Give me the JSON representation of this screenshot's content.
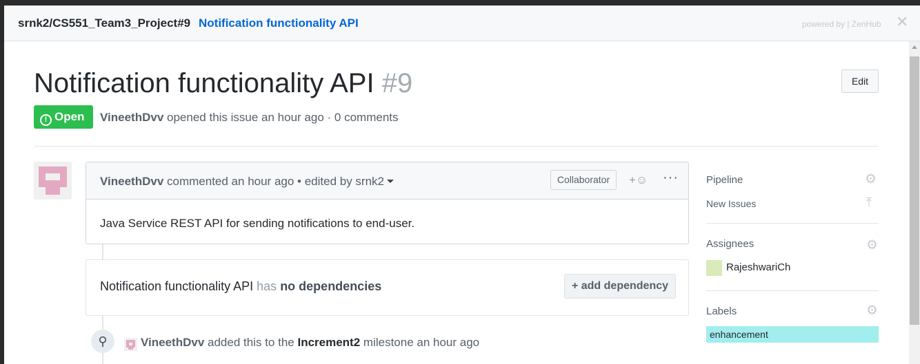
{
  "topbar": {
    "repo": "srnk2/CS551_Team3_Project#9",
    "issue_title": "Notification functionality API",
    "powered_by": "powered by | ZenHub",
    "close_icon": "close-icon"
  },
  "issue": {
    "title": "Notification functionality API",
    "number": "#9",
    "edit_label": "Edit",
    "state": "Open",
    "author": "VineethDvv",
    "meta_text": "opened this issue an hour ago · 0 comments"
  },
  "comment": {
    "author": "VineethDvv",
    "action": "commented an hour ago • edited by srnk2",
    "badge": "Collaborator",
    "reaction": "+☺",
    "more": "···",
    "body": "Java Service REST API for sending notifications to end-user."
  },
  "dependencies": {
    "title": "Notification functionality API",
    "has": "has",
    "status": "no dependencies",
    "button": "+ add dependency"
  },
  "event": {
    "actor": "VineethDvv",
    "prefix": "added this to the",
    "milestone": "Increment2",
    "suffix": "milestone an hour ago"
  },
  "sidebar": {
    "pipeline_label": "Pipeline",
    "pipeline_value": "New Issues",
    "assignees_label": "Assignees",
    "assignee": "RajeshwariCh",
    "labels_label": "Labels",
    "label": "enhancement",
    "label_color": "#a2eeef"
  },
  "colors": {
    "open_green": "#2cbe4e",
    "link_blue": "#0366d6"
  }
}
